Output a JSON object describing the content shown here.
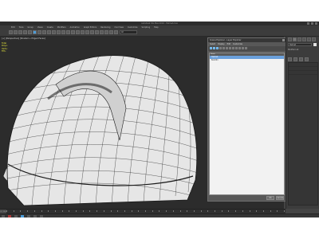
{
  "window": {
    "title": "Autodesk 3ds Max 2016 - Helmet.max"
  },
  "menubar": {
    "items": [
      "Edit",
      "Tools",
      "Group",
      "Views",
      "Create",
      "Modifiers",
      "Animation",
      "Graph Editors",
      "Rendering",
      "Civil View",
      "Customize",
      "Scripting",
      "Help"
    ]
  },
  "toolbar": {
    "selection_filter": "All",
    "active_tool": "select-icon"
  },
  "viewport": {
    "label": "[+] [Perspective] [Shaded + Edged Faces]",
    "stats": {
      "total_label": "Total",
      "polys_label": "Polys:",
      "verts_label": "Verts:",
      "fps_label": "FPS:"
    },
    "wire_color": "#1a1a1a",
    "shell_color": "#e6e6e6"
  },
  "dialog": {
    "title": "Scene Explorer - Layer Explorer",
    "menus": [
      "Select",
      "Display",
      "Edit",
      "Customize"
    ],
    "column_header": "Name",
    "rows": [
      "Helmet",
      "Box001"
    ],
    "ok_label": "OK",
    "cancel_label": "Cancel"
  },
  "command_panel": {
    "object_name": "Helmet",
    "section_label": "Modifier List",
    "swatch_color": "#e0e0e0"
  },
  "timeline": {
    "frame_label": "0 / 100"
  },
  "colors": {
    "accent": "#4a9bd8",
    "panel": "#444444",
    "viewport_bg": "#2c2c2c"
  }
}
